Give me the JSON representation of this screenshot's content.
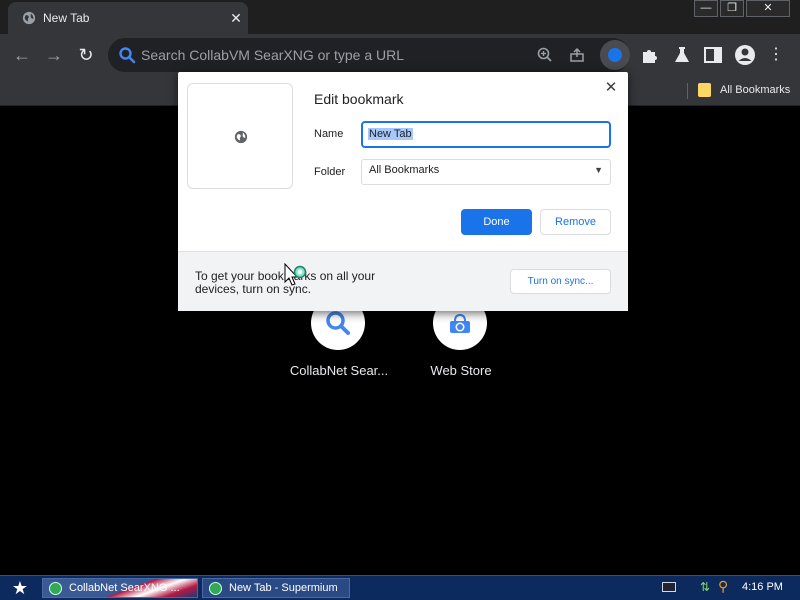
{
  "browser": {
    "tab": {
      "title": "New Tab"
    },
    "window_controls": {
      "minimize": "—",
      "restore": "❐",
      "close": "✕"
    },
    "omnibox": {
      "placeholder": "Search CollabVM SearXNG or type a URL"
    },
    "bookmarks_bar": {
      "folder_label": "All Bookmarks"
    }
  },
  "ntp": {
    "shortcuts": [
      {
        "label": "CollabNet Sear..."
      },
      {
        "label": "Web Store"
      }
    ]
  },
  "dialog": {
    "title": "Edit bookmark",
    "close_symbol": "✕",
    "name_label": "Name",
    "name_value": "New Tab",
    "folder_label": "Folder",
    "folder_value": "All Bookmarks",
    "done_label": "Done",
    "remove_label": "Remove",
    "sync_message": "To get your bookmarks on all your devices, turn on sync.",
    "sync_button": "Turn on sync..."
  },
  "taskbar": {
    "tasks": [
      {
        "label": "CollabNet SearXNG ..."
      },
      {
        "label": "New Tab - Supermium"
      }
    ],
    "clock": "4:16 PM"
  },
  "colors": {
    "accent": "#1a73e8",
    "toolbar": "#35363a",
    "page_background": "#000000",
    "taskbar": "#0c2a5e"
  }
}
